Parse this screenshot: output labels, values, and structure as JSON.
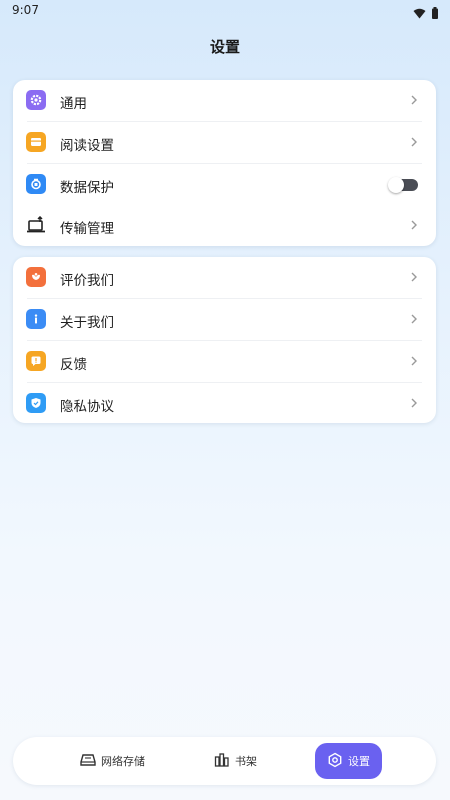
{
  "status": {
    "time": "9:07",
    "icons": [
      "wifi-icon",
      "battery-icon"
    ]
  },
  "page": {
    "title": "设置"
  },
  "group1": [
    {
      "label": "通用",
      "icon": "gear-icon",
      "color": "#8b6cf2",
      "control": "chevron"
    },
    {
      "label": "阅读设置",
      "icon": "book-icon",
      "color": "#f6a623",
      "control": "chevron"
    },
    {
      "label": "数据保护",
      "icon": "shield-lock-icon",
      "color": "#2f8af5",
      "control": "toggle"
    },
    {
      "label": "传输管理",
      "icon": "transfer-icon",
      "color": "#222222",
      "control": "chevron"
    }
  ],
  "group2": [
    {
      "label": "评价我们",
      "icon": "star-rate-icon",
      "color": "#f3703c",
      "control": "chevron"
    },
    {
      "label": "关于我们",
      "icon": "info-icon",
      "color": "#3b8cf5",
      "control": "chevron"
    },
    {
      "label": "反馈",
      "icon": "feedback-icon",
      "color": "#f6a623",
      "control": "chevron"
    },
    {
      "label": "隐私协议",
      "icon": "privacy-shield-icon",
      "color": "#2f9cf5",
      "control": "chevron"
    }
  ],
  "toggles": {
    "data_protection": false
  },
  "tabbar": {
    "tabs": [
      {
        "label": "网络存储",
        "icon": "network-storage-icon"
      },
      {
        "label": "书架",
        "icon": "bookshelf-icon"
      },
      {
        "label": "设置",
        "icon": "settings-hex-icon"
      }
    ],
    "active": "设置",
    "accent": "#6a61f0"
  }
}
